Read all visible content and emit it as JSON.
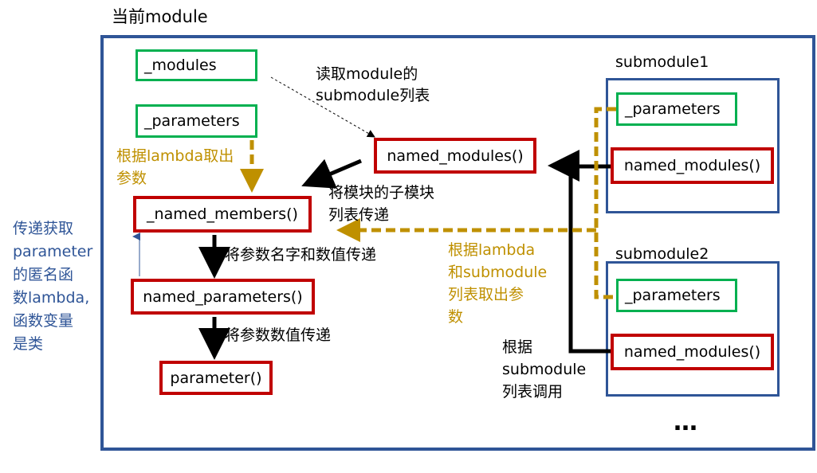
{
  "diagram": {
    "title": "当前module",
    "boxes": {
      "modules": "_modules",
      "parameters": "_parameters",
      "named_members": "_named_members()",
      "named_parameters": "named_parameters()",
      "parameter": "parameter()",
      "named_modules": "named_modules()"
    },
    "submodules": [
      {
        "title": "submodule1",
        "parameters": "_parameters",
        "named_modules": "named_modules()"
      },
      {
        "title": "submodule2",
        "parameters": "_parameters",
        "named_modules": "named_modules()"
      }
    ],
    "ellipsis": "…",
    "annotations": {
      "read_modules": "读取module的\nsubmodule列表",
      "lambda_take": "根据lambda取出\n参数",
      "pass_list": "将模块的子模块\n列表传递",
      "pass_name_value": "将参数名字和数值传递",
      "pass_value": "将参数数值传递",
      "lambda_submodule": "根据lambda\n和submodule\n列表取出参\n数",
      "call_by_list": "根据\nsubmodule\n列表调用",
      "side_note": "传递获取\nparameter\n的匿名函\n数lambda,\n函数变量\n是类"
    },
    "colors": {
      "frame": "#2F5597",
      "green_box": "#00B050",
      "red_box": "#C00000",
      "gold": "#BF9000",
      "side_note": "#2F5597"
    }
  }
}
